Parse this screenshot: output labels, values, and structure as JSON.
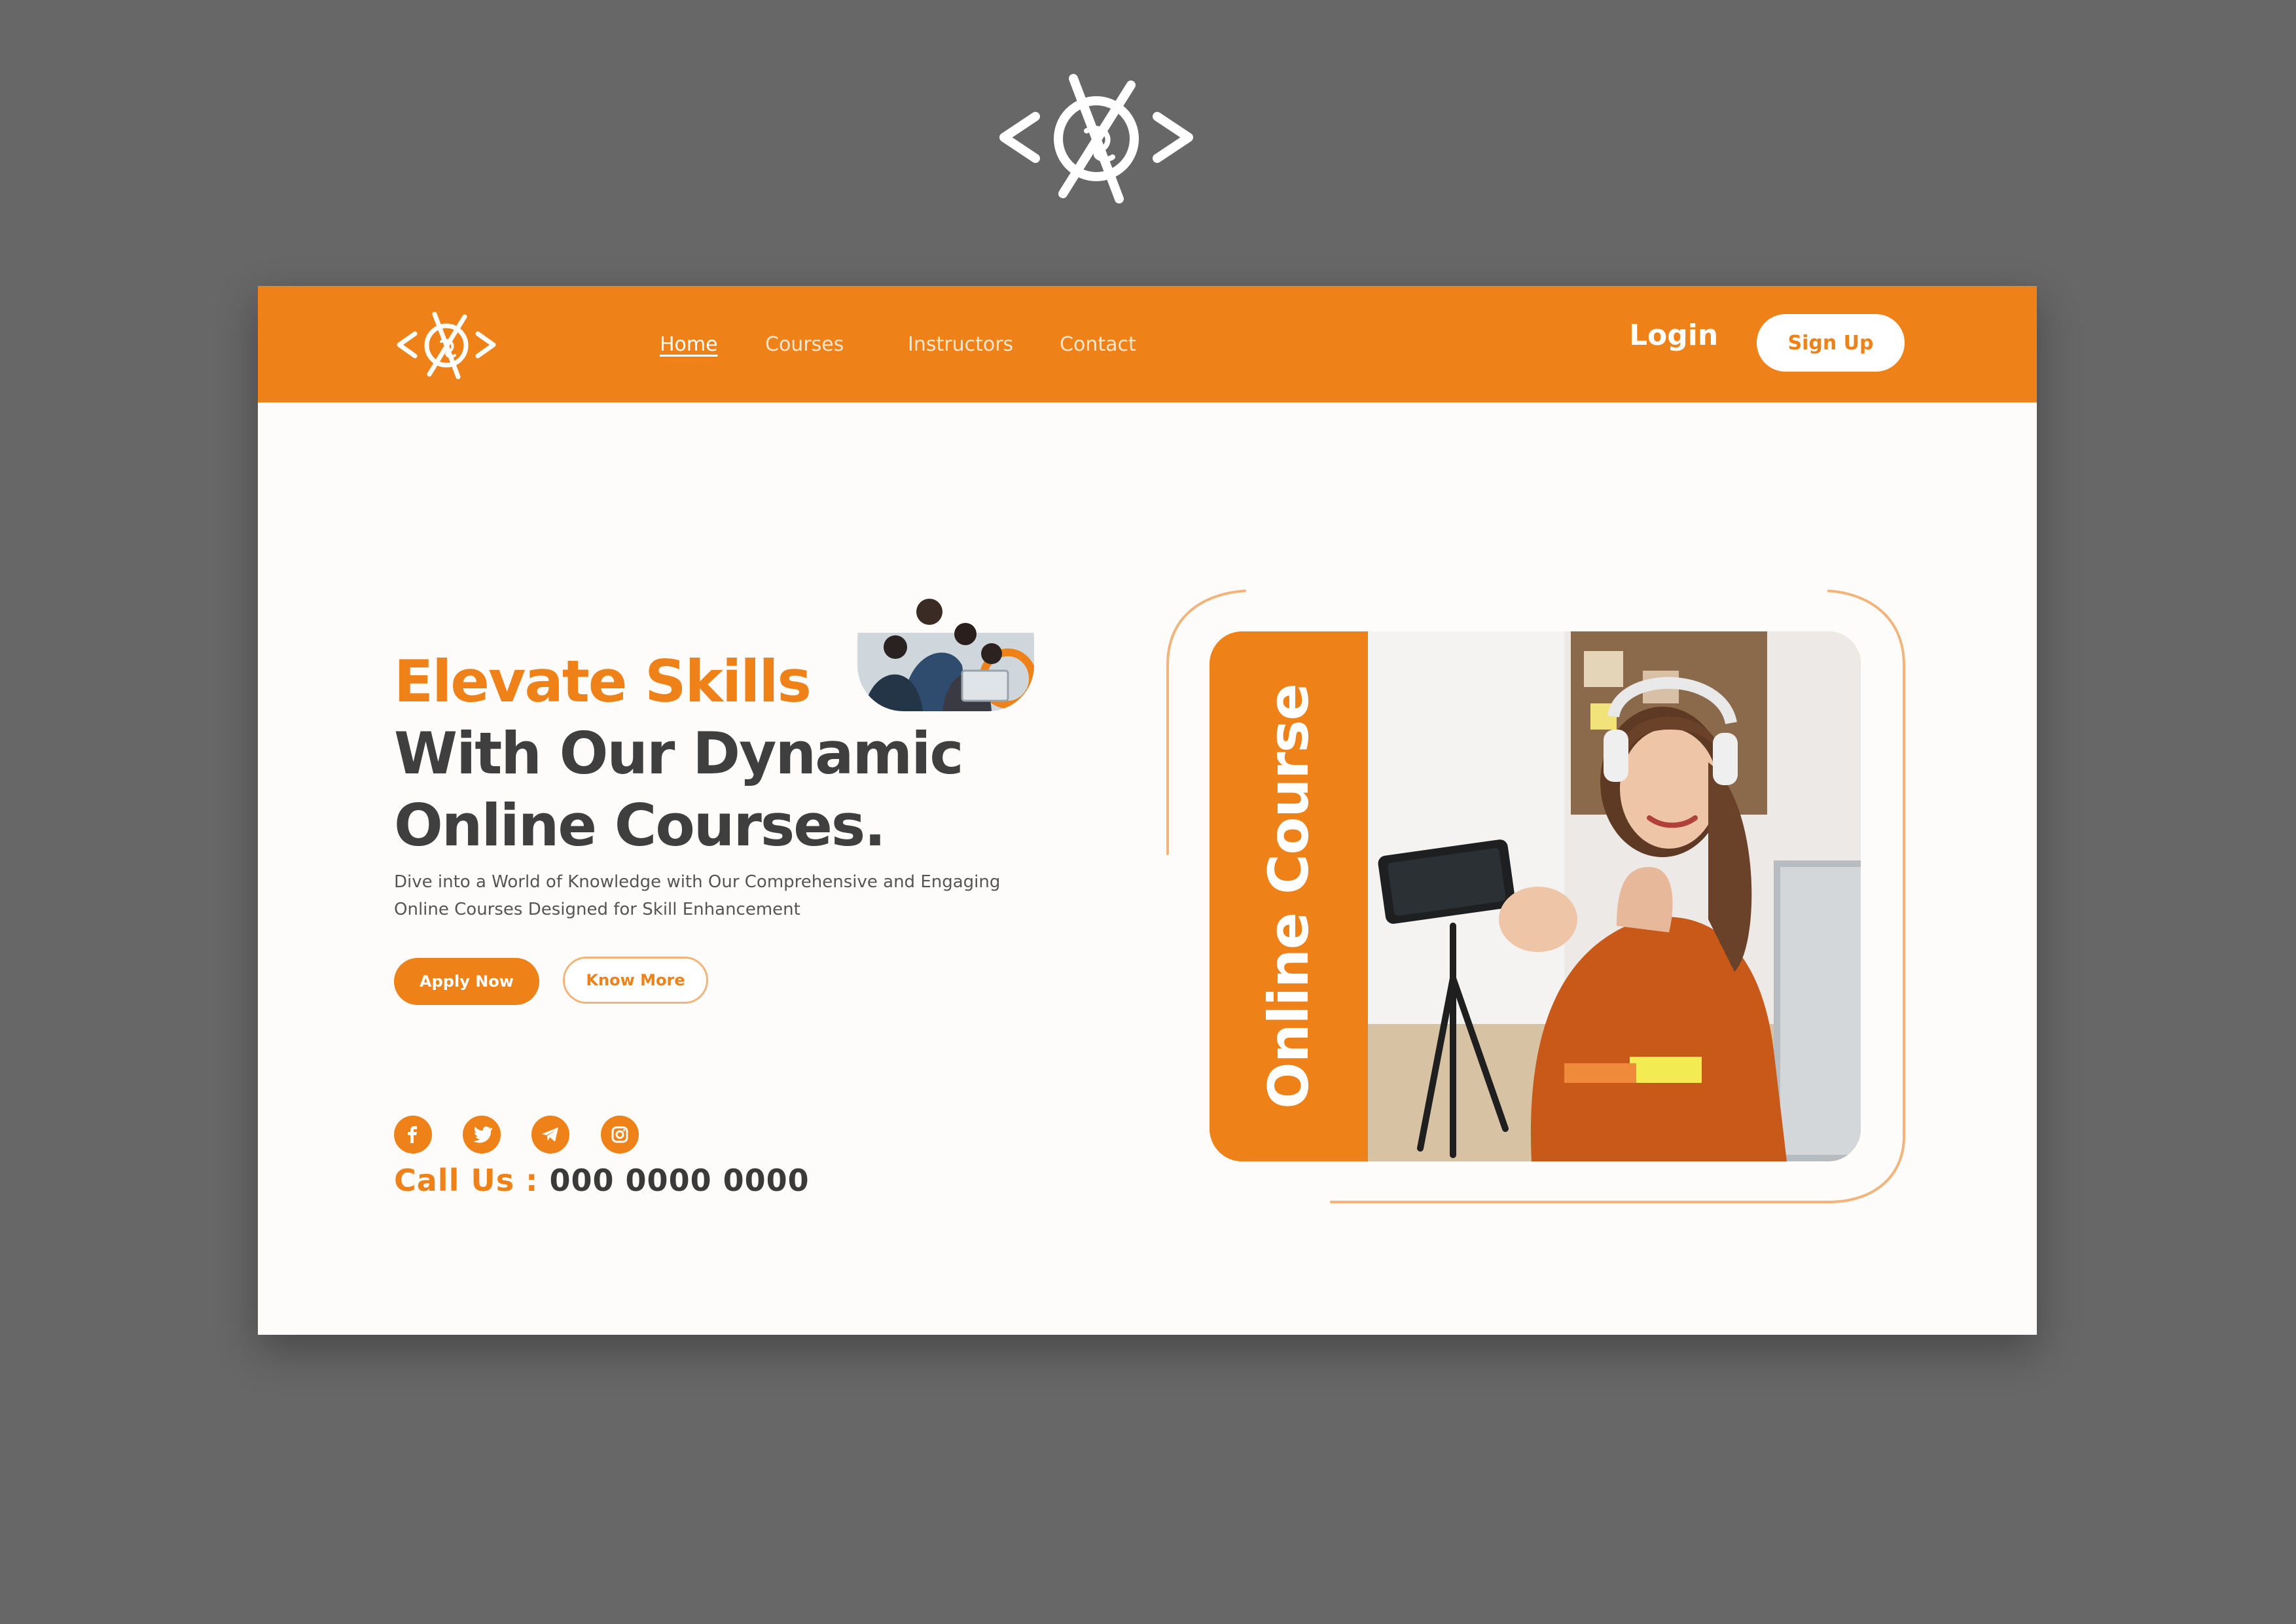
{
  "brand": {
    "logo_name": "brand-logo",
    "accent_color": "#ef8119",
    "dark_text_color": "#3f3f3f",
    "background_color": "#676767"
  },
  "nav": {
    "links": [
      {
        "label": "Home",
        "active": true
      },
      {
        "label": "Courses",
        "active": false
      },
      {
        "label": "Instructors",
        "active": false
      },
      {
        "label": "Contact",
        "active": false
      }
    ],
    "login_label": "Login",
    "signup_label": "Sign Up"
  },
  "hero": {
    "line1": "Elevate Skills",
    "line2": "With Our Dynamic",
    "line3": "Online Courses.",
    "subtitle_line1": "Dive into a World of Knowledge with Our Comprehensive and Engaging",
    "subtitle_line2": "Online Courses Designed for Skill Enhancement",
    "apply_label": "Apply Now",
    "know_more_label": "Know More"
  },
  "social": {
    "icons": [
      "facebook-icon",
      "twitter-icon",
      "telegram-icon",
      "instagram-icon"
    ]
  },
  "contact": {
    "call_label": "Call Us :",
    "phone": "000 0000 0000"
  },
  "course_card": {
    "vertical_title": "Online Course"
  }
}
